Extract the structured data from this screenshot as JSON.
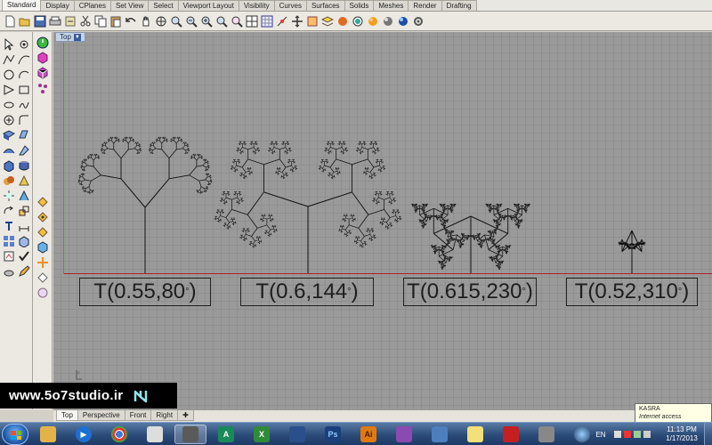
{
  "tabs": [
    "Standard",
    "Display",
    "CPlanes",
    "Set View",
    "Select",
    "Viewport Layout",
    "Visibility",
    "Curves",
    "Surfaces",
    "Solids",
    "Meshes",
    "Render",
    "Drafting"
  ],
  "active_tab": "Standard",
  "toolbar_icons": [
    "new-icon",
    "open-icon",
    "save-icon",
    "print-icon",
    "import-icon",
    "cut-icon",
    "copy-icon",
    "paste-icon",
    "undo-icon",
    "pan-icon",
    "rotate-view-icon",
    "zoom-window-icon",
    "zoom-dynamic-icon",
    "zoom-extents-icon",
    "zoom-selected-icon",
    "zoom-all-icon",
    "four-views-icon",
    "grid-snap-icon",
    "point-icon",
    "move-icon",
    "object-properties-icon",
    "layer-icon",
    "shade-icon",
    "render-icon",
    "sphere-icon",
    "light-icon",
    "material-icon",
    "options-icon"
  ],
  "viewport": {
    "title": "Top",
    "view_tabs": [
      "Top",
      "Perspective",
      "Front",
      "Right",
      "✚"
    ],
    "active_view_tab": "Top"
  },
  "labels": [
    {
      "text": "T(0.55,80",
      "deg": "°",
      "close": ")"
    },
    {
      "text": "T(0.6,144",
      "deg": "°",
      "close": ")"
    },
    {
      "text": "T(0.615,230",
      "deg": "°",
      "close": ")"
    },
    {
      "text": "T(0.52,310",
      "deg": "°",
      "close": ")"
    }
  ],
  "watermark": {
    "text": "www.5o7studio.ir"
  },
  "tooltip": {
    "line1": "KASRA",
    "line2": "Internet access"
  },
  "taskbar": {
    "lang": "EN",
    "time": "11:13 PM",
    "date": "1/17/2013",
    "apps": [
      "Windows Explorer",
      "Media Player",
      "Chrome",
      "Rhino",
      "AutoCAD",
      "Excel",
      "Arch",
      "Photoshop",
      "Illustrator",
      "App",
      "Sticky Notes",
      "Acrobat",
      "Rhino 2",
      "Globe"
    ]
  }
}
